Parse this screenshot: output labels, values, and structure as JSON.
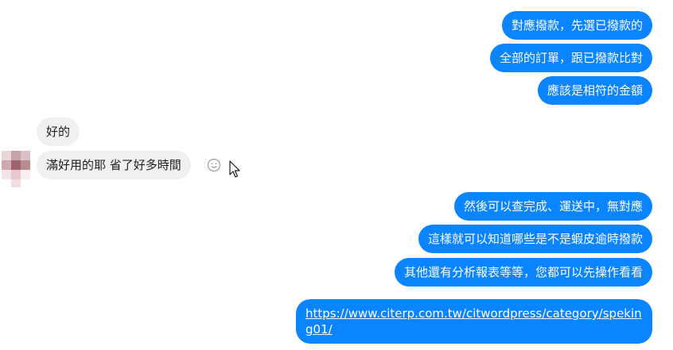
{
  "messages": {
    "out1": "對應撥款，先選已撥款的",
    "out2": "全部的訂單，跟已撥款比對",
    "out3": "應該是相符的金額",
    "in1": "好的",
    "in2": "滿好用的耶 省了好多時間",
    "out4": "然後可以查完成、運送中，無對應",
    "out5": "這樣就可以知道哪些是不是蝦皮逾時撥款",
    "out6": "其他還有分析報表等等，您都可以先操作看看",
    "link": "https://www.citerp.com.tw/citwordpress/category/speking01/"
  },
  "colors": {
    "outgoing_bubble": "#0b84ff",
    "incoming_bubble": "#f1f0f0"
  },
  "icons": {
    "emoji": "smiley-icon",
    "cursor": "mouse-pointer-icon",
    "avatar": "pixelated-avatar"
  }
}
